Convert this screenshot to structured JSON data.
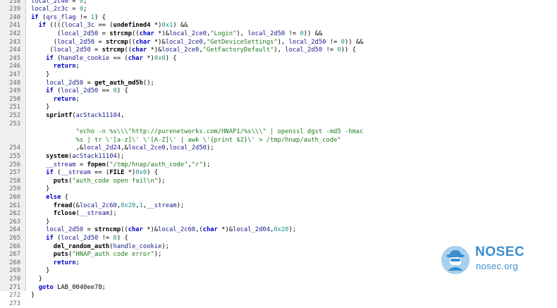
{
  "watermark": {
    "name": "NOSEC",
    "url": "nosec.org",
    "icon": "hat-avatar-icon",
    "color": "#3a8ed0"
  },
  "lines": [
    {
      "n": "238",
      "t": [
        [
          "local_2c40",
          "var"
        ],
        [
          " = ",
          "p"
        ],
        [
          "0",
          "num"
        ],
        [
          ";",
          "p"
        ]
      ]
    },
    {
      "n": "239",
      "t": [
        [
          "local_2c3c",
          "var"
        ],
        [
          " = ",
          "p"
        ],
        [
          "0",
          "num"
        ],
        [
          ";",
          "p"
        ]
      ]
    },
    {
      "n": "240",
      "t": [
        [
          "if",
          "kw"
        ],
        [
          " (",
          "p"
        ],
        [
          "qrs_flag",
          "var"
        ],
        [
          " != ",
          "p"
        ],
        [
          "1",
          "num"
        ],
        [
          ") {",
          "p"
        ]
      ]
    },
    {
      "n": "241",
      "t": [
        [
          "  if",
          "kw"
        ],
        [
          " ((((",
          "p"
        ],
        [
          "local_3c",
          "var"
        ],
        [
          " == (",
          "p"
        ],
        [
          "undefined4",
          "t"
        ],
        [
          " *)",
          "p"
        ],
        [
          "0x1",
          "num"
        ],
        [
          ") &&",
          "p"
        ]
      ]
    },
    {
      "n": "242",
      "t": [
        [
          "       (",
          "p"
        ],
        [
          "local_2d50",
          "var"
        ],
        [
          " = ",
          "p"
        ],
        [
          "strcmp",
          "fn"
        ],
        [
          "((",
          "p"
        ],
        [
          "char",
          "kw"
        ],
        [
          " *)&",
          "p"
        ],
        [
          "local_2ce0",
          "var"
        ],
        [
          ",",
          "p"
        ],
        [
          "\"Login\"",
          "str"
        ],
        [
          "), ",
          "p"
        ],
        [
          "local_2d50",
          "var"
        ],
        [
          " != ",
          "p"
        ],
        [
          "0",
          "num"
        ],
        [
          ")) &&",
          "p"
        ]
      ]
    },
    {
      "n": "243",
      "t": [
        [
          "      (",
          "p"
        ],
        [
          "local_2d50",
          "var"
        ],
        [
          " = ",
          "p"
        ],
        [
          "strcmp",
          "fn"
        ],
        [
          "((",
          "p"
        ],
        [
          "char",
          "kw"
        ],
        [
          " *)&",
          "p"
        ],
        [
          "local_2ce0",
          "var"
        ],
        [
          ",",
          "p"
        ],
        [
          "\"GetDeviceSettings\"",
          "str"
        ],
        [
          "), ",
          "p"
        ],
        [
          "local_2d50",
          "var"
        ],
        [
          " != ",
          "p"
        ],
        [
          "0",
          "num"
        ],
        [
          ")) &&",
          "p"
        ]
      ]
    },
    {
      "n": "244",
      "t": [
        [
          "     (",
          "p"
        ],
        [
          "local_2d50",
          "var"
        ],
        [
          " = ",
          "p"
        ],
        [
          "strcmp",
          "fn"
        ],
        [
          "((",
          "p"
        ],
        [
          "char",
          "kw"
        ],
        [
          " *)&",
          "p"
        ],
        [
          "local_2ce0",
          "var"
        ],
        [
          ",",
          "p"
        ],
        [
          "\"GetFactoryDefault\"",
          "str"
        ],
        [
          "), ",
          "p"
        ],
        [
          "local_2d50",
          "var"
        ],
        [
          " != ",
          "p"
        ],
        [
          "0",
          "num"
        ],
        [
          ")) {",
          "p"
        ]
      ]
    },
    {
      "n": "245",
      "t": [
        [
          "    if",
          "kw"
        ],
        [
          " (",
          "p"
        ],
        [
          "handle_cookie",
          "var"
        ],
        [
          " == (",
          "p"
        ],
        [
          "char",
          "kw"
        ],
        [
          " *)",
          "p"
        ],
        [
          "0x0",
          "num"
        ],
        [
          ") {",
          "p"
        ]
      ]
    },
    {
      "n": "246",
      "t": [
        [
          "      return",
          "kw"
        ],
        [
          ";",
          "p"
        ]
      ]
    },
    {
      "n": "247",
      "t": [
        [
          "    }",
          "p"
        ]
      ]
    },
    {
      "n": "248",
      "t": [
        [
          "    local_2d50",
          "var"
        ],
        [
          " = ",
          "p"
        ],
        [
          "get_auth_md5h",
          "fn"
        ],
        [
          "();",
          "p"
        ]
      ]
    },
    {
      "n": "249",
      "t": [
        [
          "    if",
          "kw"
        ],
        [
          " (",
          "p"
        ],
        [
          "local_2d50",
          "var"
        ],
        [
          " == ",
          "p"
        ],
        [
          "0",
          "num"
        ],
        [
          ") {",
          "p"
        ]
      ]
    },
    {
      "n": "250",
      "t": [
        [
          "      return",
          "kw"
        ],
        [
          ";",
          "p"
        ]
      ]
    },
    {
      "n": "251",
      "t": [
        [
          "    }",
          "p"
        ]
      ]
    },
    {
      "n": "252",
      "t": [
        [
          "    sprintf",
          "fn"
        ],
        [
          "(",
          "p"
        ],
        [
          "acStack11104",
          "var"
        ],
        [
          ",",
          "p"
        ]
      ]
    },
    {
      "n": "253",
      "t": []
    },
    {
      "n": "",
      "t": [
        [
          "            \"echo -n %s\\\\\\\"http://purenetworks.com/HNAP1/%s\\\\\\\" | openssl dgst -md5 -hmac",
          "str"
        ]
      ]
    },
    {
      "n": "",
      "t": [
        [
          "            %s | tr \\'[a-z]\\' \\'[A-Z]\\' | awk \\'{print $2}\\' > /tmp/hnap/auth_code\"",
          "str"
        ]
      ]
    },
    {
      "n": "254",
      "t": [
        [
          "            ,&",
          "p"
        ],
        [
          "local_2d24",
          "var"
        ],
        [
          ",&",
          "p"
        ],
        [
          "local_2ce0",
          "var"
        ],
        [
          ",",
          "p"
        ],
        [
          "local_2d50",
          "var"
        ],
        [
          ");",
          "p"
        ]
      ]
    },
    {
      "n": "255",
      "t": [
        [
          "    system",
          "fn"
        ],
        [
          "(",
          "p"
        ],
        [
          "acStack11104",
          "var"
        ],
        [
          ");",
          "p"
        ]
      ]
    },
    {
      "n": "256",
      "t": [
        [
          "    __stream",
          "var"
        ],
        [
          " = ",
          "p"
        ],
        [
          "fopen",
          "fn"
        ],
        [
          "(",
          "p"
        ],
        [
          "\"/tmp/hnap/auth_code\"",
          "str"
        ],
        [
          ",",
          "p"
        ],
        [
          "\"r\"",
          "str"
        ],
        [
          ");",
          "p"
        ]
      ]
    },
    {
      "n": "257",
      "t": [
        [
          "    if",
          "kw"
        ],
        [
          " (",
          "p"
        ],
        [
          "__stream",
          "var"
        ],
        [
          " == (",
          "p"
        ],
        [
          "FILE",
          "t"
        ],
        [
          " *)",
          "p"
        ],
        [
          "0x0",
          "num"
        ],
        [
          ") {",
          "p"
        ]
      ]
    },
    {
      "n": "258",
      "t": [
        [
          "      puts",
          "fn"
        ],
        [
          "(",
          "p"
        ],
        [
          "\"auth_code open fail\\n\"",
          "str"
        ],
        [
          ");",
          "p"
        ]
      ]
    },
    {
      "n": "259",
      "t": [
        [
          "    }",
          "p"
        ]
      ]
    },
    {
      "n": "260",
      "t": [
        [
          "    else",
          "kw"
        ],
        [
          " {",
          "p"
        ]
      ]
    },
    {
      "n": "261",
      "t": [
        [
          "      fread",
          "fn"
        ],
        [
          "(&",
          "p"
        ],
        [
          "local_2c60",
          "var"
        ],
        [
          ",",
          "p"
        ],
        [
          "0x20",
          "num"
        ],
        [
          ",",
          "p"
        ],
        [
          "1",
          "num"
        ],
        [
          ",",
          "p"
        ],
        [
          "__stream",
          "var"
        ],
        [
          ");",
          "p"
        ]
      ]
    },
    {
      "n": "262",
      "t": [
        [
          "      fclose",
          "fn"
        ],
        [
          "(",
          "p"
        ],
        [
          "__stream",
          "var"
        ],
        [
          ");",
          "p"
        ]
      ]
    },
    {
      "n": "263",
      "t": [
        [
          "    }",
          "p"
        ]
      ]
    },
    {
      "n": "264",
      "t": [
        [
          "    local_2d50",
          "var"
        ],
        [
          " = ",
          "p"
        ],
        [
          "strncmp",
          "fn"
        ],
        [
          "((",
          "p"
        ],
        [
          "char",
          "kw"
        ],
        [
          " *)&",
          "p"
        ],
        [
          "local_2c60",
          "var"
        ],
        [
          ",(",
          "p"
        ],
        [
          "char",
          "kw"
        ],
        [
          " *)&",
          "p"
        ],
        [
          "local_2d04",
          "var"
        ],
        [
          ",",
          "p"
        ],
        [
          "0x20",
          "num"
        ],
        [
          ");",
          "p"
        ]
      ]
    },
    {
      "n": "265",
      "t": [
        [
          "    if",
          "kw"
        ],
        [
          " (",
          "p"
        ],
        [
          "local_2d50",
          "var"
        ],
        [
          " != ",
          "p"
        ],
        [
          "0",
          "num"
        ],
        [
          ") {",
          "p"
        ]
      ]
    },
    {
      "n": "266",
      "t": [
        [
          "      del_random_auth",
          "fn"
        ],
        [
          "(",
          "p"
        ],
        [
          "handle_cookie",
          "var"
        ],
        [
          ");",
          "p"
        ]
      ]
    },
    {
      "n": "267",
      "t": [
        [
          "      puts",
          "fn"
        ],
        [
          "(",
          "p"
        ],
        [
          "\"HNAP_auth code error\"",
          "str"
        ],
        [
          ");",
          "p"
        ]
      ]
    },
    {
      "n": "268",
      "t": [
        [
          "      return",
          "kw"
        ],
        [
          ";",
          "p"
        ]
      ]
    },
    {
      "n": "269",
      "t": [
        [
          "    }",
          "p"
        ]
      ]
    },
    {
      "n": "270",
      "t": [
        [
          "  }",
          "p"
        ]
      ]
    },
    {
      "n": "271",
      "t": [
        [
          "  goto",
          "kw"
        ],
        [
          " LAB_0040ee78;",
          "p"
        ]
      ]
    },
    {
      "n": "272",
      "t": [
        [
          "}",
          "p"
        ]
      ]
    },
    {
      "n": "273",
      "t": []
    }
  ]
}
